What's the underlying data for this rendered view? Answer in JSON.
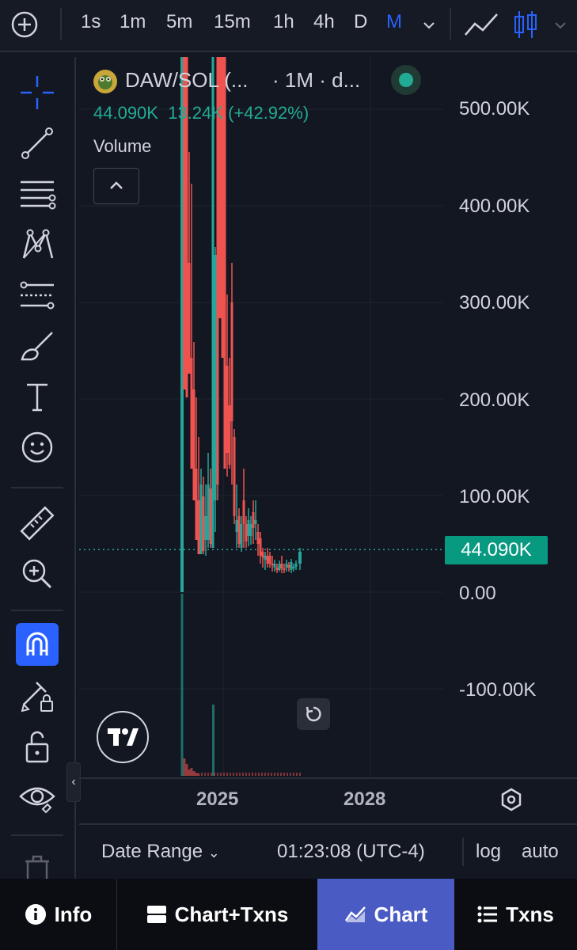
{
  "toolbar": {
    "intervals": [
      "1s",
      "1m",
      "5m",
      "15m",
      "1h",
      "4h",
      "D",
      "M"
    ],
    "active_interval": "M",
    "icons": [
      "plus-circle-icon",
      "chevron-down-icon",
      "line-chart-icon",
      "candlestick-icon",
      "chevron-down-icon"
    ]
  },
  "left_tools": [
    "crosshair-icon",
    "trend-line-icon",
    "horizontal-lines-icon",
    "pattern-icon",
    "fib-icon",
    "brush-icon",
    "text-icon",
    "emoji-icon",
    "ruler-icon",
    "zoom-in-icon",
    "magnet-icon",
    "lock-pencil-icon",
    "unlock-icon",
    "eye-icon",
    "trash-icon"
  ],
  "legend": {
    "pair": "DAW/SOL (...",
    "interval": "· 1M · d...",
    "price": "44.090K",
    "change": "13.24K (+42.92%)",
    "volume_label": "Volume"
  },
  "price_axis": [
    "500.00K",
    "400.00K",
    "300.00K",
    "200.00K",
    "100.00K",
    "0.00",
    "-100.00K"
  ],
  "current_price_tag": "44.090K",
  "time_axis": [
    "2025",
    "2028"
  ],
  "bottom_status": {
    "date_range": "Date Range",
    "time": "01:23:08 (UTC-4)",
    "log": "log",
    "auto": "auto"
  },
  "tabs": [
    {
      "label": "Info",
      "icon": "info-icon"
    },
    {
      "label": "Chart+Txns",
      "icon": "split-view-icon"
    },
    {
      "label": "Chart",
      "icon": "area-chart-icon",
      "active": true
    },
    {
      "label": "Txns",
      "icon": "list-icon"
    }
  ],
  "colors": {
    "up": "#26a69a",
    "down": "#ef5350",
    "accent": "#2962ff",
    "active_tab": "#4a5bc4",
    "price_tag": "#089981"
  },
  "chart_data": {
    "type": "candlestick",
    "pair": "DAW/SOL",
    "interval": "1M",
    "ylim": [
      -100000,
      500000
    ],
    "y_ticks": [
      500000,
      400000,
      300000,
      200000,
      100000,
      0,
      -100000
    ],
    "x_ticks": [
      "2025",
      "2028"
    ],
    "last_price": 44090
  }
}
